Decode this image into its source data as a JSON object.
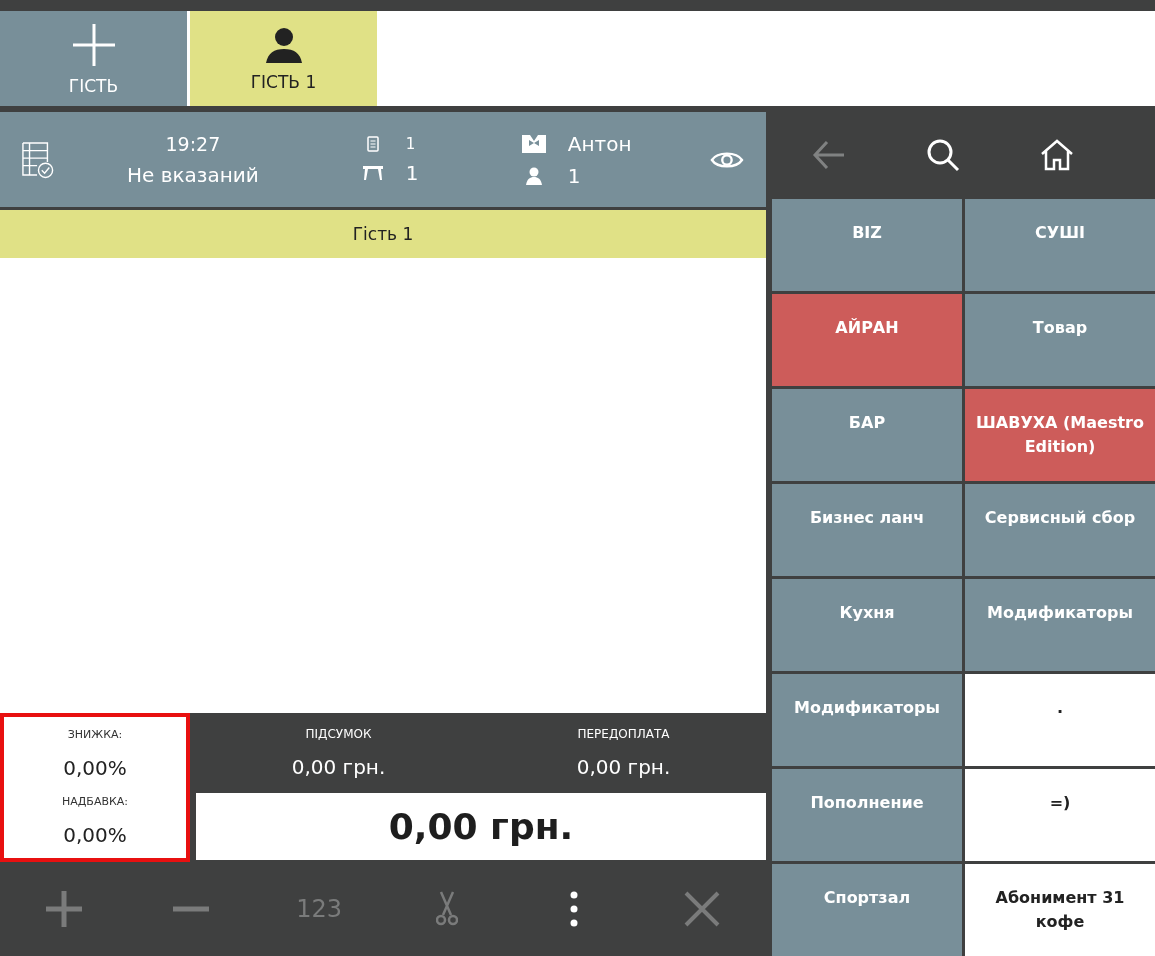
{
  "guest_tabs": [
    {
      "kind": "add",
      "label": "ГІСТЬ",
      "selected": false
    },
    {
      "kind": "guest",
      "label": "ГІСТЬ 1",
      "selected": true
    }
  ],
  "order_header": {
    "time": "19:27",
    "table_name": "Не вказаний",
    "order_number": "1",
    "table_number": "1",
    "waiter": "Антон",
    "guests_count": "1"
  },
  "guest_bar": "Гість 1",
  "adjustments": {
    "highlighted": true,
    "discount_label": "ЗНИЖКА:",
    "discount": "0,00%",
    "surcharge_label": "НАДБАВКА:",
    "surcharge": "0,00%"
  },
  "totals": {
    "subtotal_label": "ПІДСУМОК",
    "subtotal": "0,00 грн.",
    "prepayment_label": "ПЕРЕДОПЛАТА",
    "prepayment": "0,00 грн.",
    "total": "0,00 грн."
  },
  "toolbar": [
    {
      "kind": "plus",
      "disabled": true
    },
    {
      "kind": "minus",
      "disabled": true
    },
    {
      "kind": "text",
      "label": "123",
      "disabled": true
    },
    {
      "kind": "scissors",
      "disabled": true
    },
    {
      "kind": "more",
      "disabled": false
    },
    {
      "kind": "close",
      "disabled": true
    }
  ],
  "nav": {
    "back_disabled": true
  },
  "categories": [
    {
      "label": "BIZ",
      "color": "#788f99"
    },
    {
      "label": "СУШІ",
      "color": "#788f99"
    },
    {
      "label": "АЙРАН",
      "color": "#cd5c5a"
    },
    {
      "label": "Товар",
      "color": "#788f99"
    },
    {
      "label": "БАР",
      "color": "#788f99"
    },
    {
      "label": "ШАВУХА (Maestro Edition)",
      "color": "#cd5c5a"
    },
    {
      "label": "Бизнес ланч",
      "color": "#788f99"
    },
    {
      "label": "Сервисный сбор",
      "color": "#788f99"
    },
    {
      "label": "Кухня",
      "color": "#788f99"
    },
    {
      "label": "Модификаторы",
      "color": "#788f99"
    },
    {
      "label": "Модификаторы",
      "color": "#788f99"
    },
    {
      "label": ".",
      "color": "#ffffff"
    },
    {
      "label": "Пополнение",
      "color": "#788f99"
    },
    {
      "label": "=)",
      "color": "#ffffff"
    },
    {
      "label": "Спортзал",
      "color": "#788f99"
    },
    {
      "label": "Абонимент 31 кофе",
      "color": "#ffffff"
    }
  ]
}
